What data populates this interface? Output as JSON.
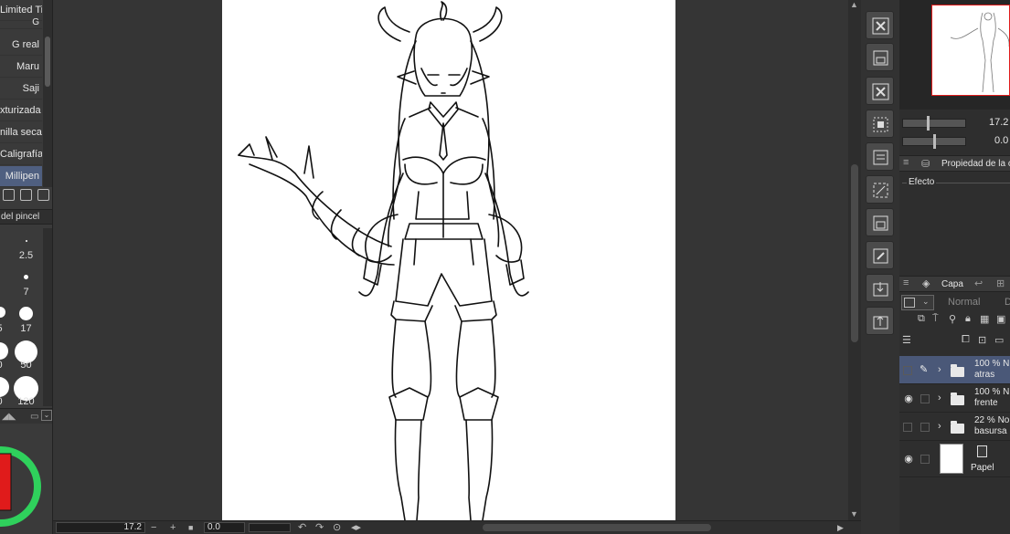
{
  "brush_list": {
    "items": [
      {
        "label": "Limited Tim",
        "selected": false
      },
      {
        "label": "G",
        "selected": false
      },
      {
        "label": "G real",
        "selected": false
      },
      {
        "label": "Maru",
        "selected": false
      },
      {
        "label": "Saji",
        "selected": false
      },
      {
        "label": "xturizada",
        "selected": false
      },
      {
        "label": "nilla seca",
        "selected": false
      },
      {
        "label": "Caligrafía",
        "selected": false
      },
      {
        "label": "Millipen",
        "selected": true
      }
    ]
  },
  "brush_size_panel": {
    "title": "del pincel",
    "sizes": [
      "2.5",
      "7",
      "5",
      "17",
      "0",
      "50",
      "0",
      "120"
    ]
  },
  "color": {
    "main": "#e01b1b",
    "wheel_ring": "#2fd15c",
    "selection_accent": "#4a5878"
  },
  "canvas": {
    "paper_color": "#ffffff"
  },
  "bottom_bar": {
    "zoom_value": "17.2",
    "rotate_value": "0.0"
  },
  "command_bar": {
    "icons": [
      "close-icon",
      "save-icon",
      "close-icon",
      "transparency-icon",
      "layer-icon",
      "crop-icon",
      "layer-icon",
      "edit-icon",
      "import-icon",
      "export-icon"
    ]
  },
  "navigator": {
    "zoom_value": "17.2",
    "rotate_value": "0.0"
  },
  "tool_property": {
    "tab_label": "Propiedad de la c",
    "effect_label": "Efecto"
  },
  "layer_panel": {
    "tab_label": "Capa",
    "blend_mode": "Normal",
    "blend_suffix": "D",
    "layers": [
      {
        "opacity_mode": "100 % N",
        "name": "atras",
        "visible": false,
        "selected": true,
        "editing": true,
        "type": "folder"
      },
      {
        "opacity_mode": "100 % N",
        "name": "frente",
        "visible": true,
        "selected": false,
        "editing": false,
        "type": "folder"
      },
      {
        "opacity_mode": "22 % No",
        "name": "basursa",
        "visible": false,
        "selected": false,
        "editing": false,
        "type": "folder"
      },
      {
        "opacity_mode": "",
        "name": "Papel",
        "visible": true,
        "selected": false,
        "editing": false,
        "type": "paper"
      }
    ]
  }
}
